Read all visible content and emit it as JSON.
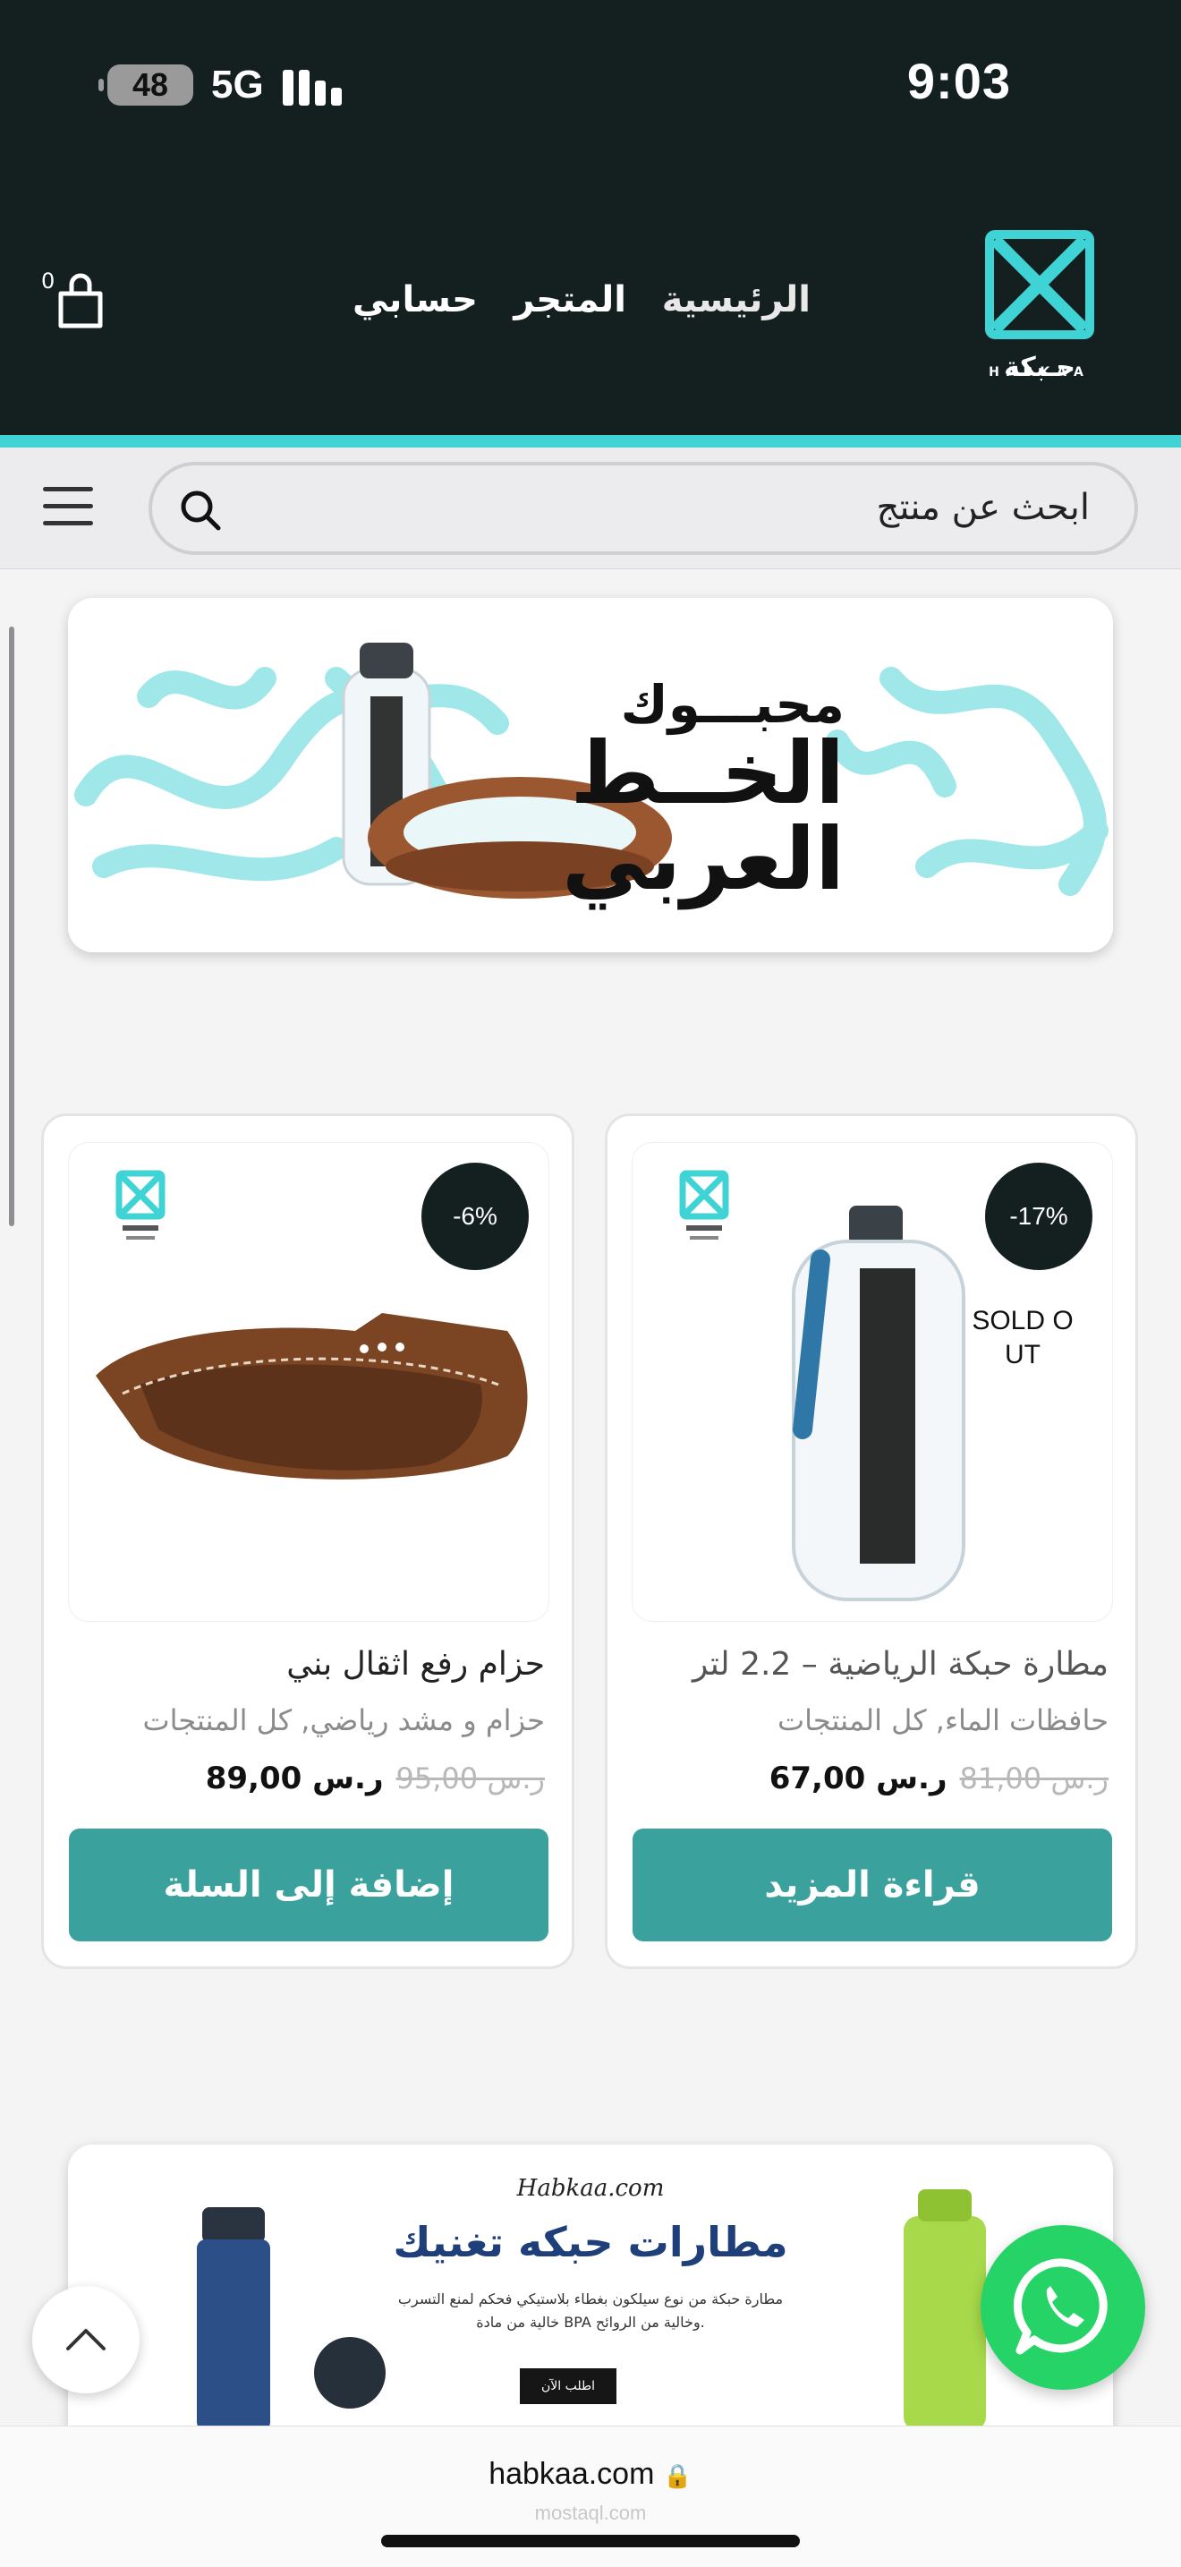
{
  "status_bar": {
    "time": "9:03",
    "battery": "48",
    "network": "5G"
  },
  "header": {
    "logo_text": "حـبكة",
    "logo_word": "HABKAA",
    "nav": [
      "الرئيسية",
      "المتجر",
      "حسابي"
    ],
    "cart_count": "0",
    "colors": {
      "dark": "#141f20",
      "accent": "#3fd3d6",
      "button": "#3aa19d"
    }
  },
  "search": {
    "placeholder": "ابحث عن منتج",
    "icon": "search-icon"
  },
  "banner": {
    "line1": "محبـــوك",
    "line2": "الخــط",
    "line3": "العربي"
  },
  "products": [
    {
      "title": "مطارة حبكة الرياضية – 2.2 لتر",
      "categories": "حافظات الماء, كل المنتجات",
      "badge": "-17%",
      "sold_out": "SOLD OUT",
      "price_old": "81,00 ر.س",
      "price_new": "67,00 ر.س",
      "button": "قراءة المزيد"
    },
    {
      "title": "حزام رفع اثقال بني",
      "categories": "حزام و مشد رياضي, كل المنتجات",
      "badge": "-6%",
      "price_old": "95,00 ر.س",
      "price_new": "89,00 ر.س",
      "button": "إضافة إلى السلة"
    }
  ],
  "banner2": {
    "site": "Habkaa.com",
    "title": "مطارات حبكه تغنيك",
    "desc_line1": "مطارة حبكة من نوع سيلكون بغطاء بلاستيكي فحكم لمنع التسرب",
    "desc_line2": "خالية من مادة BPA وخالية من الروائح.",
    "button": "اطلب الآن"
  },
  "browser": {
    "url": "habkaa.com",
    "watermark": "mostaql.com"
  }
}
